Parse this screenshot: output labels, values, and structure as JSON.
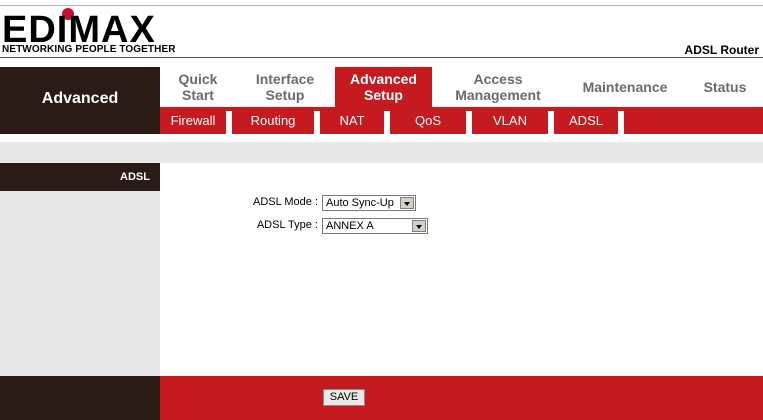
{
  "brand": {
    "logo": "EDIMAX",
    "tagline": "NETWORKING PEOPLE TOGETHER",
    "product": "ADSL Router",
    "accent_color": "#c41a20",
    "dark_color": "#2b1b17"
  },
  "section_title": "Advanced",
  "tabs": [
    {
      "line1": "Quick",
      "line2": "Start"
    },
    {
      "line1": "Interface",
      "line2": "Setup"
    },
    {
      "line1": "Advanced",
      "line2": "Setup",
      "active": true
    },
    {
      "line1": "Access",
      "line2": "Management"
    },
    {
      "line1": "Maintenance",
      "line2": ""
    },
    {
      "line1": "Status",
      "line2": ""
    }
  ],
  "subnav": [
    "Firewall",
    "Routing",
    "NAT",
    "QoS",
    "VLAN",
    "ADSL"
  ],
  "sidebar": {
    "current": "ADSL"
  },
  "form": {
    "mode_label": "ADSL Mode :",
    "mode_value": "Auto Sync-Up",
    "type_label": "ADSL Type :",
    "type_value": "ANNEX A"
  },
  "footer": {
    "save_label": "SAVE"
  }
}
